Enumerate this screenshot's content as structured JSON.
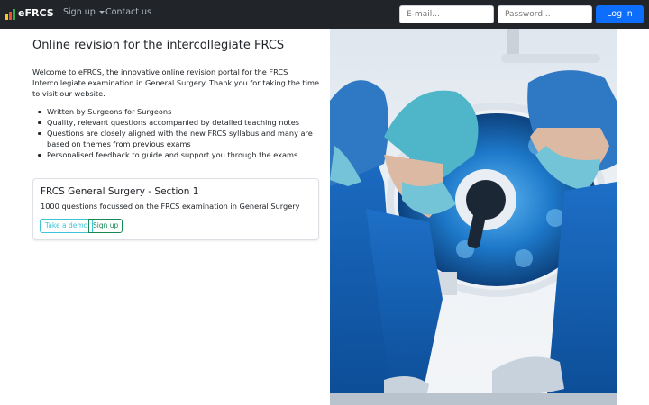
{
  "navbar": {
    "brand": "eFRCS",
    "brand_colors": [
      "#f7c52b",
      "#e8532d",
      "#3aa84a",
      "#e8532d"
    ],
    "signup_label": "Sign up",
    "contact_label": "Contact us",
    "email_placeholder": "E-mail...",
    "password_placeholder": "Password...",
    "login_label": "Log in"
  },
  "main": {
    "title": "Online revision for the intercollegiate FRCS",
    "intro": "Welcome to eFRCS, the innovative online revision portal for the FRCS Intercollegiate examination in General Surgery. Thank you for taking the time to visit our website.",
    "features": [
      "Written by Surgeons for Surgeons",
      "Quality, relevant questions accompanied by detailed teaching notes",
      "Questions are closely aligned with the new FRCS syllabus and many are based on themes from previous exams",
      "Personalised feedback to guide and support you through the exams"
    ],
    "card": {
      "title": "FRCS General Surgery - Section 1",
      "text": "1000 questions focussed on the FRCS examination in General Surgery",
      "demo_label": "Take a demo",
      "signup_label": "Sign up"
    }
  },
  "colors": {
    "navbar_bg": "#212529",
    "primary": "#0d6efd",
    "info": "#3dc4d8",
    "success": "#198754"
  },
  "image": {
    "subject": "surgeons-under-operating-lamp"
  }
}
